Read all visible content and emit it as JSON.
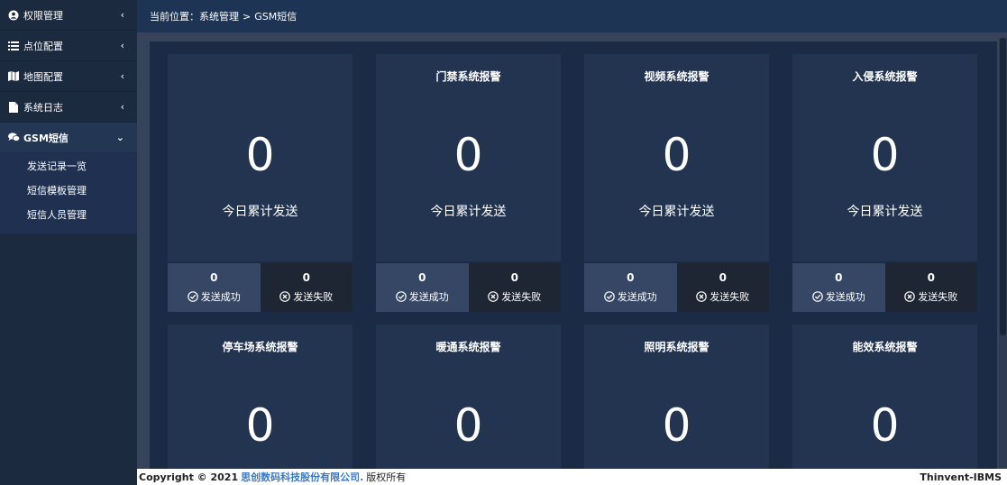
{
  "sidebar": {
    "items": [
      {
        "label": "权限管理",
        "icon": "user-circle-icon",
        "chevron": "‹"
      },
      {
        "label": "点位配置",
        "icon": "list-icon",
        "chevron": "‹"
      },
      {
        "label": "地图配置",
        "icon": "map-icon",
        "chevron": "‹"
      },
      {
        "label": "系统日志",
        "icon": "file-icon",
        "chevron": "‹"
      },
      {
        "label": "GSM短信",
        "icon": "chat-icon",
        "chevron": "⌄"
      }
    ],
    "submenu": [
      {
        "label": "发送记录一览"
      },
      {
        "label": "短信模板管理"
      },
      {
        "label": "短信人员管理"
      }
    ]
  },
  "breadcrumb": {
    "prefix": "当前位置：",
    "level1": "系统管理",
    "separator": ">",
    "level2": "GSM短信"
  },
  "cards_row1": [
    {
      "title": "",
      "count": "0",
      "caption": "今日累计发送",
      "success": "0",
      "success_label": "发送成功",
      "fail": "0",
      "fail_label": "发送失败"
    },
    {
      "title": "门禁系统报警",
      "count": "0",
      "caption": "今日累计发送",
      "success": "0",
      "success_label": "发送成功",
      "fail": "0",
      "fail_label": "发送失败"
    },
    {
      "title": "视频系统报警",
      "count": "0",
      "caption": "今日累计发送",
      "success": "0",
      "success_label": "发送成功",
      "fail": "0",
      "fail_label": "发送失败"
    },
    {
      "title": "入侵系统报警",
      "count": "0",
      "caption": "今日累计发送",
      "success": "0",
      "success_label": "发送成功",
      "fail": "0",
      "fail_label": "发送失败"
    }
  ],
  "cards_row2": [
    {
      "title": "停车场系统报警",
      "count": "0"
    },
    {
      "title": "暖通系统报警",
      "count": "0"
    },
    {
      "title": "照明系统报警",
      "count": "0"
    },
    {
      "title": "能效系统报警",
      "count": "0"
    }
  ],
  "footer": {
    "copyright": "Copyright © 2021",
    "company": "思创数码科技股份有限公司.",
    "rights": "版权所有",
    "brand": "Thinvent-IBMS"
  },
  "colors": {
    "sidebar_bg": "#1c2a3f",
    "topbar_bg": "#1e3455",
    "card_bg": "#22344f",
    "link": "#3a78c2"
  }
}
